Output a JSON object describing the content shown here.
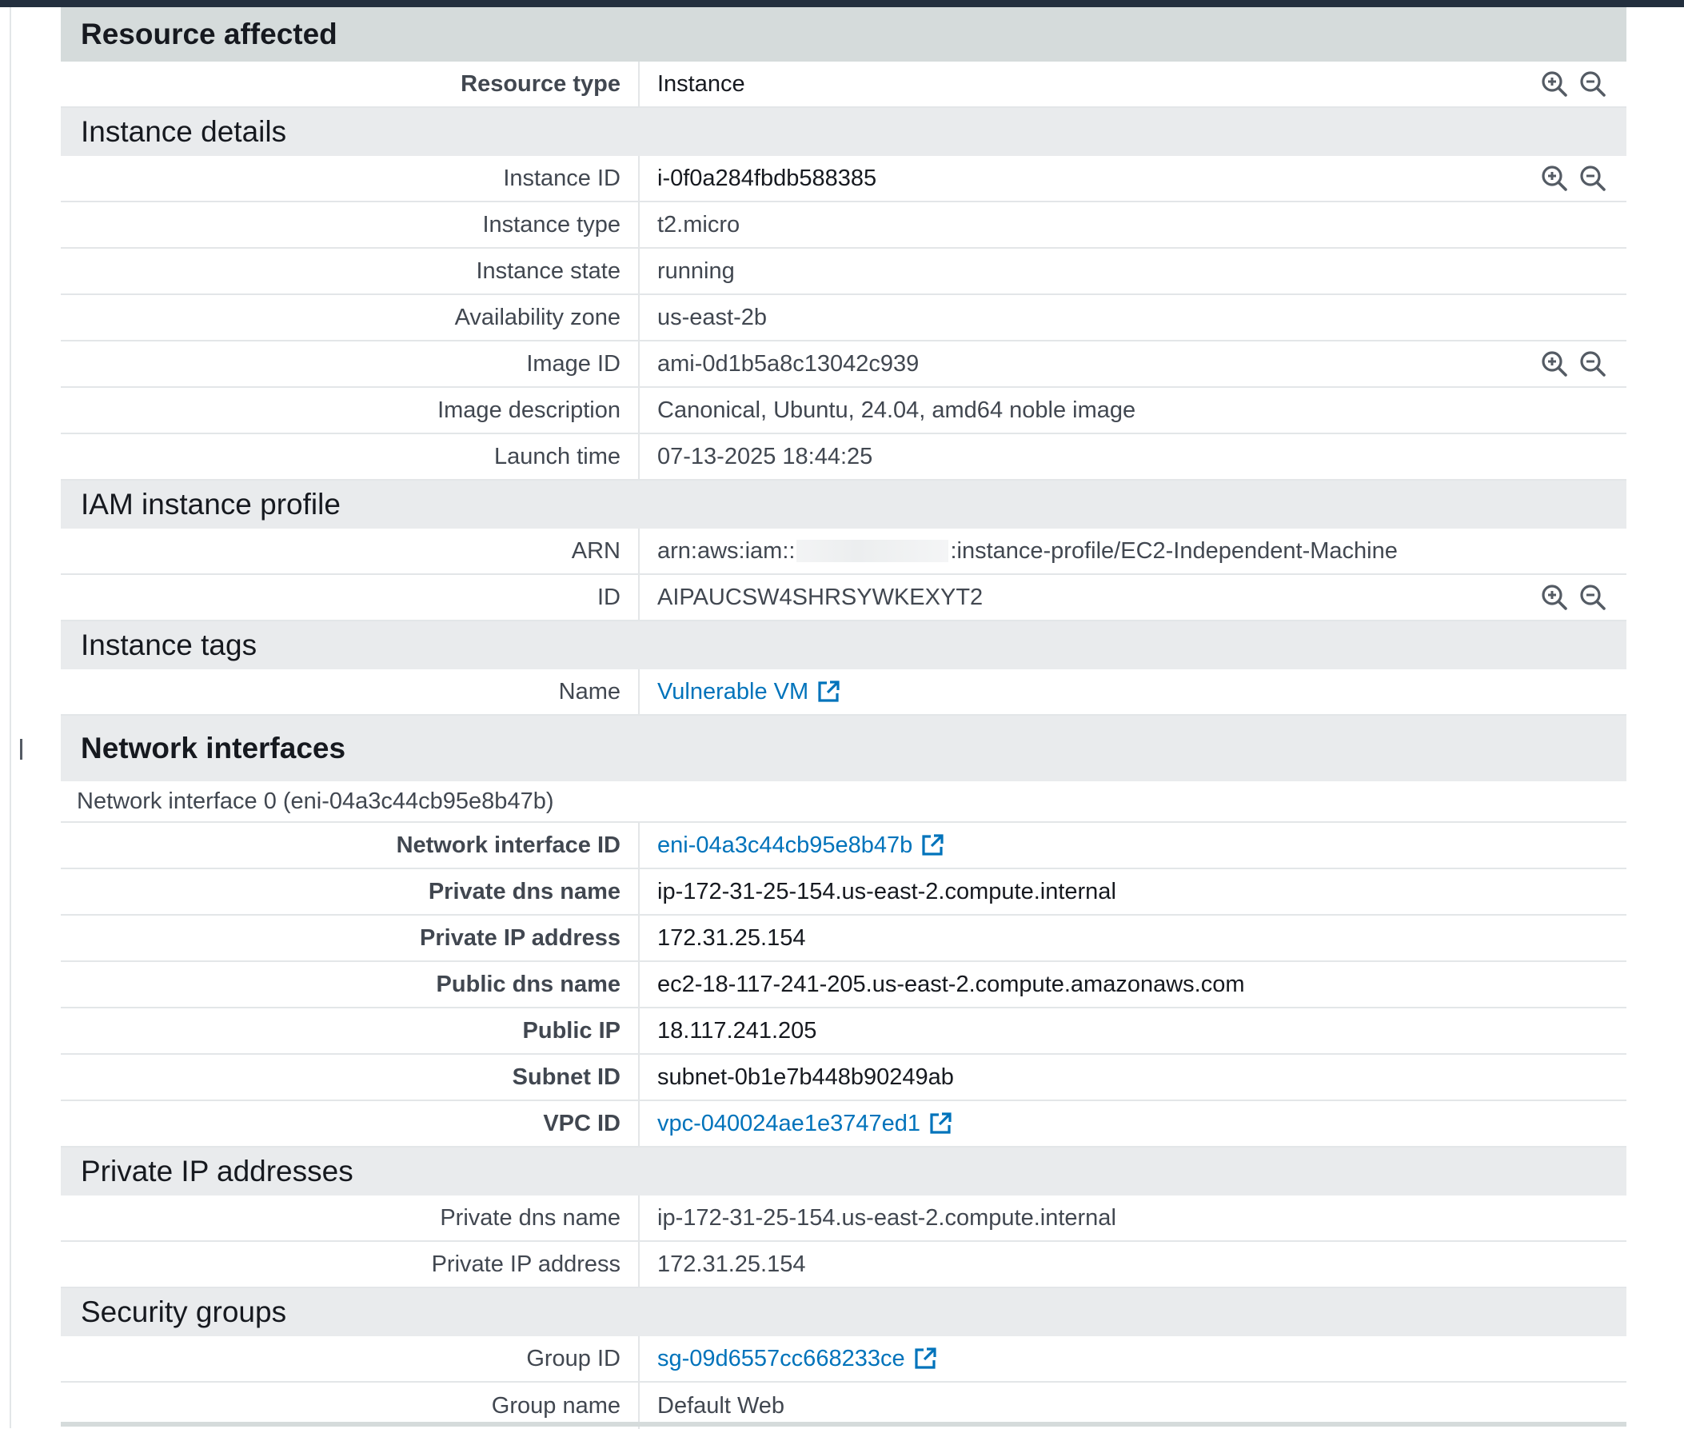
{
  "resource_affected": {
    "title": "Resource affected",
    "rows": [
      {
        "label": "Resource type",
        "value": "Instance"
      }
    ]
  },
  "instance_details": {
    "title": "Instance details",
    "rows": [
      {
        "label": "Instance ID",
        "value": "i-0f0a284fbdb588385"
      },
      {
        "label": "Instance type",
        "value": "t2.micro"
      },
      {
        "label": "Instance state",
        "value": "running"
      },
      {
        "label": "Availability zone",
        "value": "us-east-2b"
      },
      {
        "label": "Image ID",
        "value": "ami-0d1b5a8c13042c939"
      },
      {
        "label": "Image description",
        "value": "Canonical, Ubuntu, 24.04, amd64 noble image"
      },
      {
        "label": "Launch time",
        "value": "07-13-2025 18:44:25"
      }
    ]
  },
  "iam_instance_profile": {
    "title": "IAM instance profile",
    "rows": [
      {
        "label": "ARN",
        "value_prefix": "arn:aws:iam::",
        "value_suffix": ":instance-profile/EC2-Independent-Machine"
      },
      {
        "label": "ID",
        "value": "AIPAUCSW4SHRSYWKEXYT2"
      }
    ]
  },
  "instance_tags": {
    "title": "Instance tags",
    "rows": [
      {
        "label": "Name",
        "value": "Vulnerable VM"
      }
    ]
  },
  "network_interfaces": {
    "title": "Network interfaces",
    "caption": "Network interface 0 (eni-04a3c44cb95e8b47b)",
    "rows": [
      {
        "label": "Network interface ID",
        "value": "eni-04a3c44cb95e8b47b"
      },
      {
        "label": "Private dns name",
        "value": "ip-172-31-25-154.us-east-2.compute.internal"
      },
      {
        "label": "Private IP address",
        "value": "172.31.25.154"
      },
      {
        "label": "Public dns name",
        "value": "ec2-18-117-241-205.us-east-2.compute.amazonaws.com"
      },
      {
        "label": "Public IP",
        "value": "18.117.241.205"
      },
      {
        "label": "Subnet ID",
        "value": "subnet-0b1e7b448b90249ab"
      },
      {
        "label": "VPC ID",
        "value": "vpc-040024ae1e3747ed1"
      }
    ]
  },
  "private_ip_addresses": {
    "title": "Private IP addresses",
    "rows": [
      {
        "label": "Private dns name",
        "value": "ip-172-31-25-154.us-east-2.compute.internal"
      },
      {
        "label": "Private IP address",
        "value": "172.31.25.154"
      }
    ]
  },
  "security_groups": {
    "title": "Security groups",
    "rows": [
      {
        "label": "Group ID",
        "value": "sg-09d6557cc668233ce"
      },
      {
        "label": "Group name",
        "value": "Default Web"
      }
    ]
  },
  "icons": {
    "zoom_in": "zoom-in-icon",
    "zoom_out": "zoom-out-icon",
    "external_link": "external-link-icon"
  },
  "colors": {
    "link": "#0073bb",
    "header_bg": "#e9ebed",
    "header_bg_strong": "#d5dbdb",
    "topbar": "#232f3e"
  }
}
